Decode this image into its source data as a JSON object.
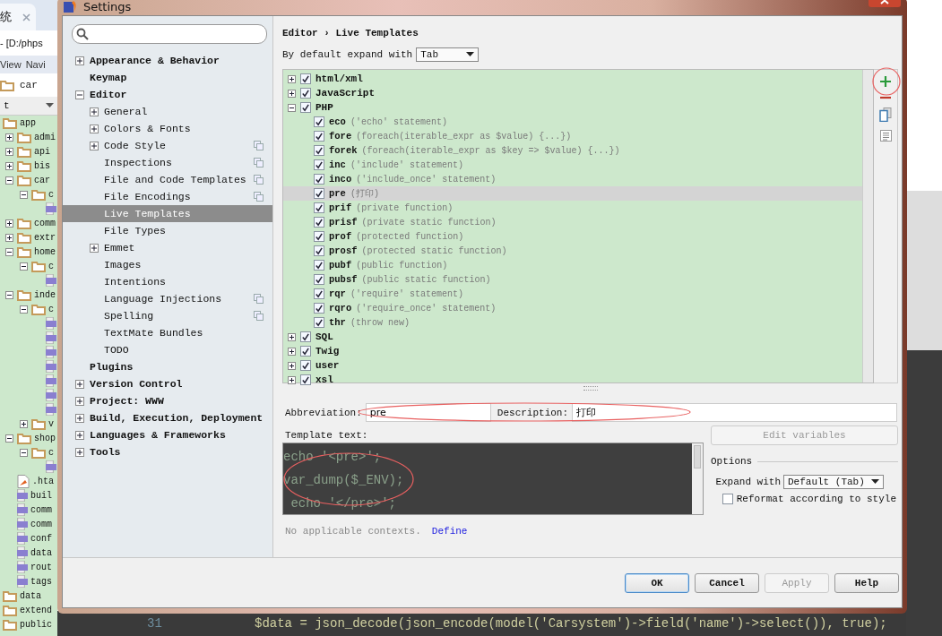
{
  "background": {
    "tab": "统",
    "title": "- [D:/phps",
    "menu": [
      "View",
      "Navi"
    ],
    "breadcrumb": "car",
    "view_select": "t",
    "project_tree": [
      {
        "label": "app",
        "kind": "folder",
        "children": [
          {
            "label": "admi",
            "kind": "folder",
            "expanded": false
          },
          {
            "label": "api",
            "kind": "folder",
            "expanded": false
          },
          {
            "label": "bis",
            "kind": "folder",
            "expanded": false
          },
          {
            "label": "car",
            "kind": "folder",
            "expanded": true,
            "children": [
              {
                "label": "c",
                "kind": "folder",
                "expanded": true,
                "children": [
                  {
                    "kind": "php"
                  }
                ]
              }
            ]
          },
          {
            "label": "comm",
            "kind": "folder",
            "expanded": false
          },
          {
            "label": "extr",
            "kind": "folder",
            "expanded": false
          },
          {
            "label": "home",
            "kind": "folder",
            "expanded": true,
            "children": [
              {
                "label": "c",
                "kind": "folder",
                "expanded": true,
                "children": [
                  {
                    "kind": "php"
                  }
                ]
              }
            ]
          },
          {
            "label": "inde",
            "kind": "folder",
            "expanded": true,
            "children": [
              {
                "label": "c",
                "kind": "folder",
                "expanded": true,
                "children": [
                  {
                    "kind": "php"
                  },
                  {
                    "kind": "php"
                  },
                  {
                    "kind": "php"
                  },
                  {
                    "kind": "php"
                  },
                  {
                    "kind": "php"
                  },
                  {
                    "kind": "php"
                  },
                  {
                    "kind": "php"
                  }
                ]
              },
              {
                "label": "v",
                "kind": "folder",
                "expanded": false
              }
            ]
          },
          {
            "label": "shop",
            "kind": "folder",
            "expanded": true,
            "children": [
              {
                "label": "c",
                "kind": "folder",
                "expanded": true,
                "children": [
                  {
                    "kind": "php"
                  }
                ]
              }
            ]
          },
          {
            "label": ".hta",
            "kind": "file"
          },
          {
            "label": "buil",
            "kind": "php"
          },
          {
            "label": "comm",
            "kind": "php"
          },
          {
            "label": "comm",
            "kind": "php"
          },
          {
            "label": "conf",
            "kind": "php"
          },
          {
            "label": "data",
            "kind": "php"
          },
          {
            "label": "rout",
            "kind": "php"
          },
          {
            "label": "tags",
            "kind": "php"
          }
        ]
      },
      {
        "label": "data",
        "kind": "folder"
      },
      {
        "label": "extend",
        "kind": "folder"
      },
      {
        "label": "public",
        "kind": "folder"
      }
    ],
    "code_line": {
      "number": "31",
      "code": "$data = json_decode(json_encode(model('Carsystem')->field('name')->select()), true);"
    }
  },
  "window": {
    "title": "Settings"
  },
  "sidebar": {
    "items": [
      {
        "label": "Appearance & Behavior",
        "expanded": false,
        "selected": false
      },
      {
        "label": "Keymap",
        "selected": false
      },
      {
        "label": "Editor",
        "expanded": true,
        "selected": false,
        "children": [
          {
            "label": "General",
            "expanded": false,
            "selected": false
          },
          {
            "label": "Colors & Fonts",
            "expanded": false,
            "selected": false
          },
          {
            "label": "Code Style",
            "expanded": false,
            "selected": false,
            "project_level": true
          },
          {
            "label": "Inspections",
            "selected": false,
            "project_level": true
          },
          {
            "label": "File and Code Templates",
            "selected": false,
            "project_level": true
          },
          {
            "label": "File Encodings",
            "selected": false,
            "project_level": true
          },
          {
            "label": "Live Templates",
            "selected": true
          },
          {
            "label": "File Types",
            "selected": false
          },
          {
            "label": "Emmet",
            "expanded": false,
            "selected": false
          },
          {
            "label": "Images",
            "selected": false
          },
          {
            "label": "Intentions",
            "selected": false
          },
          {
            "label": "Language Injections",
            "selected": false,
            "project_level": true
          },
          {
            "label": "Spelling",
            "selected": false,
            "project_level": true
          },
          {
            "label": "TextMate Bundles",
            "selected": false
          },
          {
            "label": "TODO",
            "selected": false
          }
        ]
      },
      {
        "label": "Plugins",
        "selected": false
      },
      {
        "label": "Version Control",
        "expanded": false,
        "selected": false
      },
      {
        "label": "Project: WWW",
        "expanded": false,
        "selected": false
      },
      {
        "label": "Build, Execution, Deployment",
        "expanded": false,
        "selected": false
      },
      {
        "label": "Languages & Frameworks",
        "expanded": false,
        "selected": false
      },
      {
        "label": "Tools",
        "expanded": false,
        "selected": false
      }
    ]
  },
  "breadcrumb": "Editor › Live Templates",
  "expand_default": {
    "label": "By default expand with",
    "value": "Tab"
  },
  "templates": [
    {
      "name": "html/xml",
      "checked": true,
      "expanded": false
    },
    {
      "name": "JavaScript",
      "checked": true,
      "expanded": false
    },
    {
      "name": "PHP",
      "checked": true,
      "expanded": true,
      "children": [
        {
          "abbr": "eco",
          "desc": "('echo' statement)",
          "checked": true,
          "selected": false
        },
        {
          "abbr": "fore",
          "desc": "(foreach(iterable_expr as $value) {...})",
          "checked": true,
          "selected": false
        },
        {
          "abbr": "forek",
          "desc": "(foreach(iterable_expr as $key => $value) {...})",
          "checked": true,
          "selected": false
        },
        {
          "abbr": "inc",
          "desc": "('include' statement)",
          "checked": true,
          "selected": false
        },
        {
          "abbr": "inco",
          "desc": "('include_once' statement)",
          "checked": true,
          "selected": false
        },
        {
          "abbr": "pre",
          "desc": "(打印)",
          "checked": true,
          "selected": true
        },
        {
          "abbr": "prif",
          "desc": "(private function)",
          "checked": true,
          "selected": false
        },
        {
          "abbr": "prisf",
          "desc": "(private static function)",
          "checked": true,
          "selected": false
        },
        {
          "abbr": "prof",
          "desc": "(protected function)",
          "checked": true,
          "selected": false
        },
        {
          "abbr": "prosf",
          "desc": "(protected static function)",
          "checked": true,
          "selected": false
        },
        {
          "abbr": "pubf",
          "desc": "(public function)",
          "checked": true,
          "selected": false
        },
        {
          "abbr": "pubsf",
          "desc": "(public static function)",
          "checked": true,
          "selected": false
        },
        {
          "abbr": "rqr",
          "desc": "('require' statement)",
          "checked": true,
          "selected": false
        },
        {
          "abbr": "rqro",
          "desc": "('require_once' statement)",
          "checked": true,
          "selected": false
        },
        {
          "abbr": "thr",
          "desc": "(throw new)",
          "checked": true,
          "selected": false
        }
      ]
    },
    {
      "name": "SQL",
      "checked": true,
      "expanded": false
    },
    {
      "name": "Twig",
      "checked": true,
      "expanded": false
    },
    {
      "name": "user",
      "checked": true,
      "expanded": false
    },
    {
      "name": "xsl",
      "checked": true,
      "expanded": false
    }
  ],
  "abbreviation": {
    "label": "Abbreviation:",
    "value": "pre"
  },
  "description": {
    "label": "Description:",
    "value": "打印"
  },
  "template_text": {
    "label": "Template text:",
    "lines": [
      "echo '<pre>';",
      "var_dump($_ENV);",
      " echo '</pre>';"
    ]
  },
  "edit_variables": {
    "label": "Edit variables",
    "disabled": true
  },
  "options": {
    "title": "Options",
    "expand_label": "Expand with",
    "expand_value": "Default (Tab)",
    "reformat": {
      "label": "Reformat according to style",
      "checked": false
    }
  },
  "contexts": {
    "text": "No applicable contexts.",
    "link": "Define"
  },
  "buttons": [
    {
      "label": "OK",
      "disabled": false,
      "default": true
    },
    {
      "label": "Cancel",
      "disabled": false,
      "default": false
    },
    {
      "label": "Apply",
      "disabled": true,
      "default": false
    },
    {
      "label": "Help",
      "disabled": false,
      "default": false
    }
  ]
}
